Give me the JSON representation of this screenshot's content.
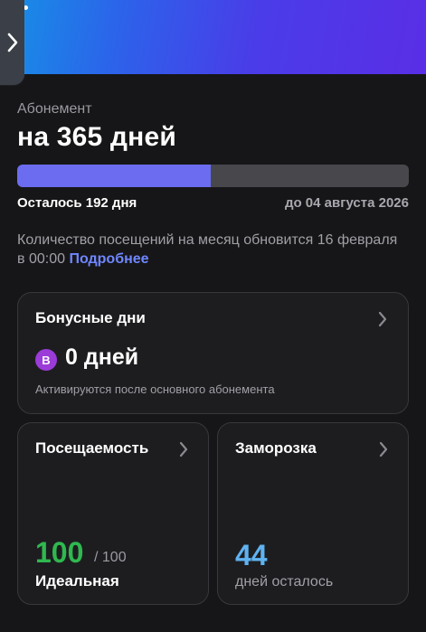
{
  "hero": {
    "colors": [
      "#1592e6",
      "#4a3ce8",
      "#5a2ee6"
    ]
  },
  "side_tab": {
    "icon": "chevron-right-icon"
  },
  "subscription": {
    "label": "Абонемент",
    "title": "на 365 дней",
    "progress_fraction": 0.4932,
    "remaining": "Осталось 192 дня",
    "until": "до 04 августа 2026",
    "info_text": "Количество посещений на месяц обновится 16 февраля в 00:00",
    "info_link": "Подробнее"
  },
  "bonus": {
    "title": "Бонусные дни",
    "badge": "B",
    "value": "0 дней",
    "note": "Активируются после основного абонемента"
  },
  "attendance": {
    "title": "Посещаемость",
    "value": "100",
    "max": "/ 100",
    "label": "Идеальная"
  },
  "freeze": {
    "title": "Заморозка",
    "value": "44",
    "label": "дней осталось"
  },
  "colors": {
    "accent": "#6b6cf0",
    "link": "#6f87ff",
    "attendance": "#2fb84f",
    "freeze": "#5fb2f0",
    "badge": "#9b3bd8"
  }
}
